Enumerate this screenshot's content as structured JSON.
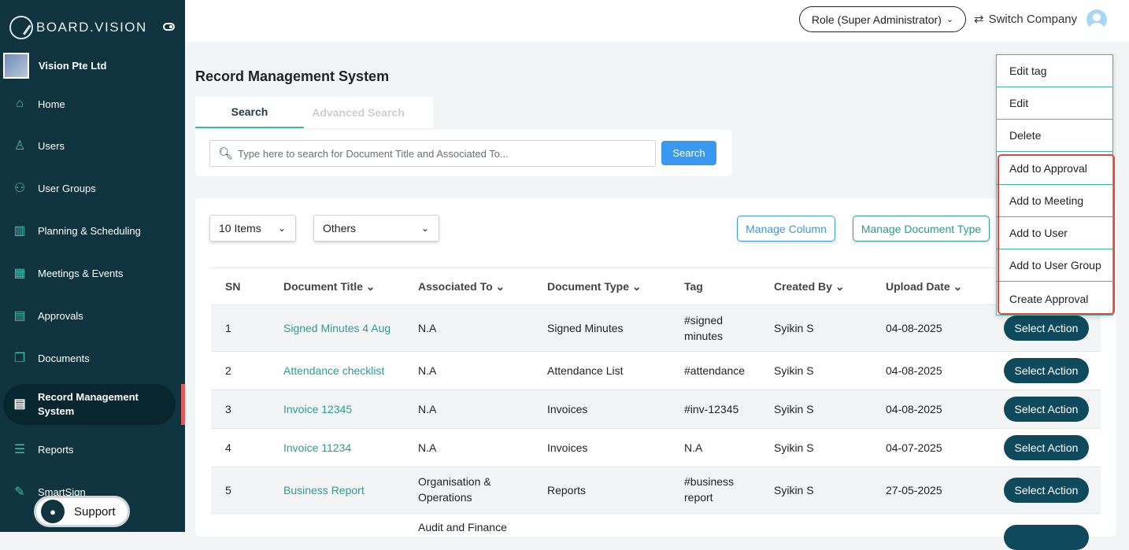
{
  "brand": {
    "name": "BOARD.VISION"
  },
  "company": {
    "name": "Vision Pte Ltd"
  },
  "sidebar": {
    "items": [
      {
        "label": "Home",
        "icon": "home-icon"
      },
      {
        "label": "Users",
        "icon": "user-icon"
      },
      {
        "label": "User Groups",
        "icon": "user-group-icon"
      },
      {
        "label": "Planning & Scheduling",
        "icon": "planning-icon"
      },
      {
        "label": "Meetings & Events",
        "icon": "calendar-icon"
      },
      {
        "label": "Approvals",
        "icon": "approval-icon"
      },
      {
        "label": "Documents",
        "icon": "documents-icon"
      },
      {
        "label": "Record Management System",
        "icon": "record-icon",
        "active": true
      },
      {
        "label": "Reports",
        "icon": "reports-icon"
      },
      {
        "label": "SmartSign",
        "icon": "smartsign-icon"
      }
    ],
    "support_label": "Support"
  },
  "topbar": {
    "role_label": "Role (Super Administrator)",
    "switch_label": "Switch Company"
  },
  "page": {
    "title": "Record Management System"
  },
  "tabs": [
    {
      "label": "Search",
      "active": true
    },
    {
      "label": "Advanced Search",
      "active": false
    }
  ],
  "search": {
    "placeholder": "Type here to search for Document Title and Associated To...",
    "button_label": "Search"
  },
  "toolbar": {
    "page_size": "10 Items",
    "filter": "Others",
    "manage_column": "Manage Column",
    "manage_document_type": "Manage Document Type"
  },
  "table": {
    "headers": [
      "SN",
      "Document Title",
      "Associated To",
      "Document Type",
      "Tag",
      "Created By",
      "Upload Date"
    ],
    "rows": [
      {
        "sn": "1",
        "title": "Signed Minutes 4 Aug",
        "associated": "N.A",
        "type": "Signed Minutes",
        "tag": "#signed minutes",
        "created_by": "Syikin S",
        "date": "04-08-2025",
        "action": "Select Action"
      },
      {
        "sn": "2",
        "title": "Attendance checklist",
        "associated": "N.A",
        "type": "Attendance List",
        "tag": "#attendance",
        "created_by": "Syikin S",
        "date": "04-08-2025",
        "action": "Select Action"
      },
      {
        "sn": "3",
        "title": "Invoice 12345",
        "associated": "N.A",
        "type": "Invoices",
        "tag": "#inv-12345",
        "created_by": "Syikin S",
        "date": "04-08-2025",
        "action": "Select Action"
      },
      {
        "sn": "4",
        "title": "Invoice 11234",
        "associated": "N.A",
        "type": "Invoices",
        "tag": "N.A",
        "created_by": "Syikin S",
        "date": "04-07-2025",
        "action": "Select Action"
      },
      {
        "sn": "5",
        "title": "Business Report",
        "associated": "Organisation & Operations",
        "type": "Reports",
        "tag": "#business report",
        "created_by": "Syikin S",
        "date": "27-05-2025",
        "action": "Select Action"
      },
      {
        "sn": "",
        "title": "",
        "associated": "Audit and Finance",
        "type": "",
        "tag": "",
        "created_by": "",
        "date": "",
        "action": ""
      }
    ]
  },
  "action_menu": {
    "items": [
      "Edit tag",
      "Edit",
      "Delete",
      "Add to Approval",
      "Add to Meeting",
      "Add to User",
      "Add to User Group",
      "Create Approval"
    ]
  },
  "colors": {
    "sidebar": "#0f3440",
    "accent": "#2a9d8f",
    "primary_button": "#3a98f0",
    "action_button": "#0f4a5c",
    "highlight": "#e0473f"
  }
}
